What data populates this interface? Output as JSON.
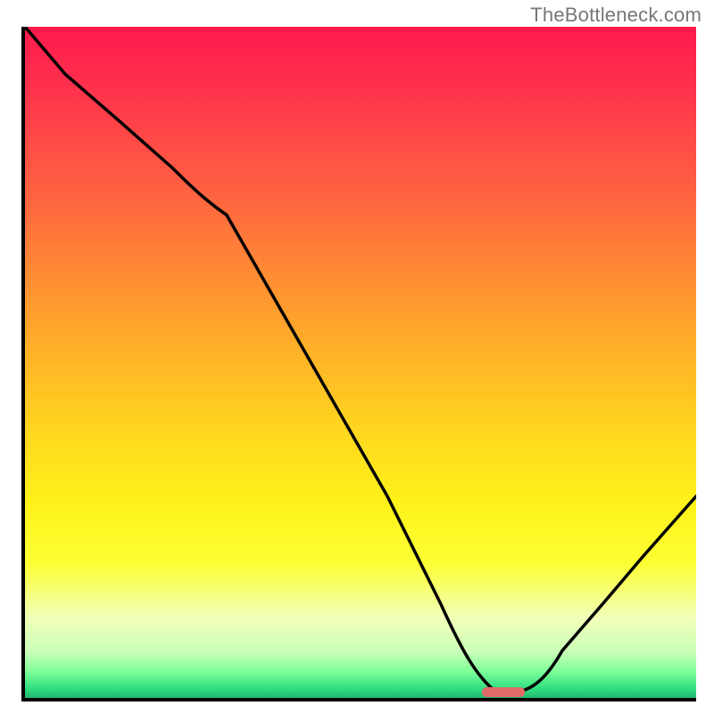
{
  "watermark": "TheBottleneck.com",
  "chart_data": {
    "type": "line",
    "title": "",
    "xlabel": "",
    "ylabel": "",
    "xlim": [
      0,
      100
    ],
    "ylim": [
      0,
      100
    ],
    "grid": false,
    "legend": false,
    "background": {
      "type": "vertical-gradient",
      "stops": [
        {
          "pos": 0,
          "color": "#ff1a4d",
          "meaning": "high-bottleneck"
        },
        {
          "pos": 50,
          "color": "#ffb327"
        },
        {
          "pos": 75,
          "color": "#fff21a"
        },
        {
          "pos": 95,
          "color": "#7fff99"
        },
        {
          "pos": 100,
          "color": "#1fb86e",
          "meaning": "optimal"
        }
      ]
    },
    "series": [
      {
        "name": "bottleneck-curve",
        "x": [
          0,
          6,
          14,
          22,
          30,
          38,
          46,
          54,
          62,
          67,
          70,
          74,
          80,
          86,
          92,
          100
        ],
        "y": [
          100,
          93,
          86,
          79,
          72,
          58,
          44,
          30,
          14,
          4,
          1,
          1,
          7,
          14,
          21,
          30
        ]
      }
    ],
    "optimal_marker": {
      "x_center": 71,
      "width": 6,
      "y": 0.5,
      "color": "#e16a68"
    }
  }
}
